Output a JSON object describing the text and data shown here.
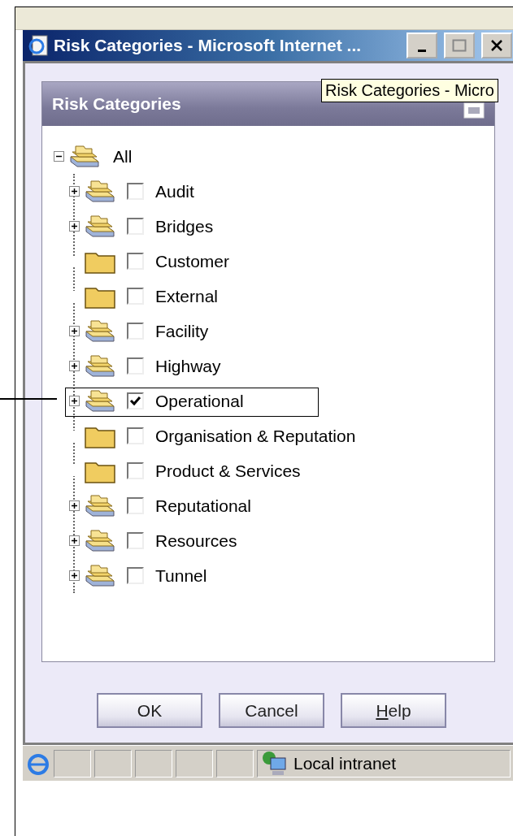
{
  "window": {
    "title": "Risk Categories - Microsoft Internet ..."
  },
  "tooltip": "Risk Categories - Micro",
  "panel": {
    "title": "Risk Categories"
  },
  "tree": {
    "label": "All",
    "expanded": true,
    "children": [
      {
        "label": "Audit",
        "kind": "group",
        "expanded": false,
        "checked": false
      },
      {
        "label": "Bridges",
        "kind": "group",
        "expanded": false,
        "checked": false
      },
      {
        "label": "Customer",
        "kind": "leaf",
        "checked": false
      },
      {
        "label": "External",
        "kind": "leaf",
        "checked": false
      },
      {
        "label": "Facility",
        "kind": "group",
        "expanded": false,
        "checked": false
      },
      {
        "label": "Highway",
        "kind": "group",
        "expanded": false,
        "checked": false
      },
      {
        "label": "Operational",
        "kind": "group",
        "expanded": false,
        "checked": true,
        "highlighted": true
      },
      {
        "label": "Organisation & Reputation",
        "kind": "leaf",
        "checked": false
      },
      {
        "label": "Product & Services",
        "kind": "leaf",
        "checked": false
      },
      {
        "label": "Reputational",
        "kind": "group",
        "expanded": false,
        "checked": false
      },
      {
        "label": "Resources",
        "kind": "group",
        "expanded": false,
        "checked": false
      },
      {
        "label": "Tunnel",
        "kind": "group",
        "expanded": false,
        "checked": false
      }
    ]
  },
  "buttons": [
    {
      "label": "OK",
      "mnemonic": false
    },
    {
      "label": "Cancel",
      "mnemonic": false
    },
    {
      "label": "Help",
      "mnemonic": true
    }
  ],
  "status_bar": {
    "zone": "Local intranet"
  }
}
